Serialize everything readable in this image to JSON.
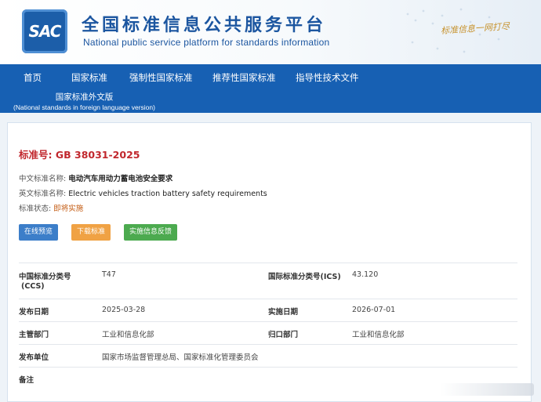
{
  "header": {
    "logo_text": "SAC",
    "title_cn": "全国标准信息公共服务平台",
    "title_en": "National public service platform  for standards information",
    "slogan": "标准信息一网打尽"
  },
  "nav": {
    "items": [
      {
        "label": "首页"
      },
      {
        "label": "国家标准"
      },
      {
        "label": "强制性国家标准"
      },
      {
        "label": "推荐性国家标准"
      },
      {
        "label": "指导性技术文件"
      }
    ],
    "foreign_cn": "国家标准外文版",
    "foreign_en": "(National standards in foreign language version)"
  },
  "standard": {
    "number_label": "标准号:",
    "number": "GB 38031-2025",
    "cn_name_label": "中文标准名称:",
    "cn_name": "电动汽车用动力蓄电池安全要求",
    "en_name_label": "英文标准名称:",
    "en_name": "Electric vehicles traction battery safety requirements",
    "status_label": "标准状态:",
    "status": "即将实施"
  },
  "buttons": {
    "preview": "在线预览",
    "download": "下载标准",
    "feedback": "实施信息反馈"
  },
  "details": {
    "ccs_label_1": "中国标准分类号",
    "ccs_label_2": "(CCS)",
    "ccs_value": "T47",
    "ics_label": "国际标准分类号(ICS)",
    "ics_value": "43.120",
    "publish_label": "发布日期",
    "publish_value": "2025-03-28",
    "impl_label": "实施日期",
    "impl_value": "2026-07-01",
    "dept_label": "主管部门",
    "dept_value": "工业和信息化部",
    "guikou_label": "归口部门",
    "guikou_value": "工业和信息化部",
    "issuer_label": "发布单位",
    "issuer_value": "国家市场监督管理总局、国家标准化管理委员会",
    "remark_label": "备注"
  },
  "colors": {
    "brand_blue": "#1760b3",
    "title_red": "#c1272d",
    "btn_blue": "#3c7ec9",
    "btn_orange": "#f0a244",
    "btn_green": "#4caa4f"
  }
}
